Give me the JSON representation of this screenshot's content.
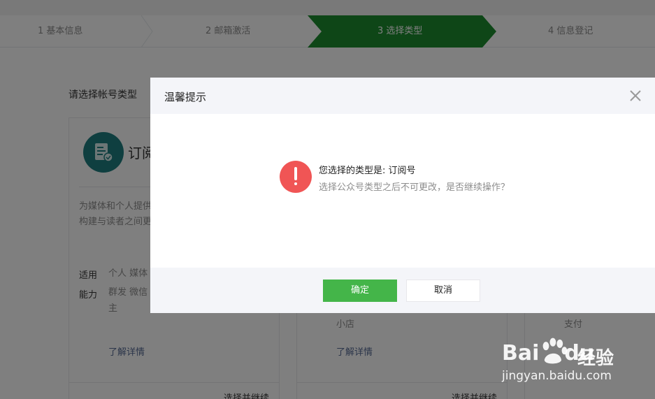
{
  "steps": [
    {
      "label": "1 基本信息",
      "active": false
    },
    {
      "label": "2 邮箱激活",
      "active": false
    },
    {
      "label": "3 选择类型",
      "active": true
    },
    {
      "label": "4 信息登记",
      "active": false
    }
  ],
  "colors": {
    "active_step": "#1d8c2e",
    "primary_button": "#44b549",
    "warning": "#f05555",
    "link": "#576b95"
  },
  "page": {
    "title": "请选择帐号类型",
    "cards": [
      {
        "name_partial": "订阅",
        "icon": "subscription-doc-icon",
        "desc_line1": "为媒体和个人提供",
        "desc_line2": "构建与读者之间更",
        "row1_label": "适用",
        "row1_value": "个人 媒体",
        "row2_label": "能力",
        "row2_value_line1": "群发 微信",
        "row2_value_line2": "主",
        "link": "了解详情",
        "action": "选择并继续"
      },
      {
        "row_value": "小店",
        "link": "了解详情",
        "action": "选择并继续"
      },
      {
        "row_value": "支付"
      }
    ]
  },
  "dialog": {
    "title": "温馨提示",
    "close_icon": "close-icon",
    "warning_icon": "exclamation-icon",
    "message_title": "您选择的类型是: 订阅号",
    "message_sub": "选择公众号类型之后不可更改，是否继续操作？",
    "confirm_label": "确定",
    "cancel_label": "取消"
  },
  "watermark": {
    "logo_left": "Bai",
    "logo_right": "du",
    "logo_cn": "经验",
    "url": "jingyan.baidu.com"
  }
}
